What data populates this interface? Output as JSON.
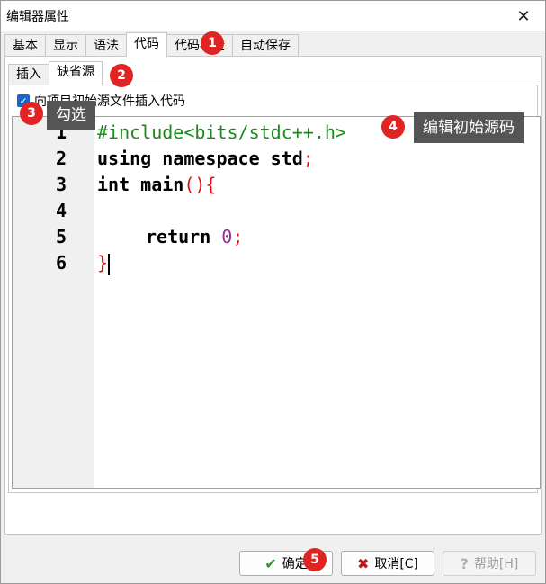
{
  "window": {
    "title": "编辑器属性"
  },
  "tabs": [
    "基本",
    "显示",
    "语法",
    "代码",
    "代码补全",
    "自动保存"
  ],
  "subtabs": [
    "插入",
    "缺省源"
  ],
  "checkbox": {
    "label": "向项目初始源文件插入代码",
    "checked": true
  },
  "editor": {
    "line_numbers": [
      "1",
      "2",
      "3",
      "4",
      "5",
      "6"
    ],
    "lines": {
      "l1": "#include<bits/stdc++.h>",
      "l2_kw": "using namespace std",
      "l2_p": ";",
      "l3_kw": "int main",
      "l3_p": "(){",
      "l5_kw": "return ",
      "l5_num": "0",
      "l5_p": ";",
      "l6_p": "}"
    }
  },
  "buttons": {
    "ok": {
      "label": "确定",
      "icon": "check-icon"
    },
    "cancel": {
      "label": "取消[C]",
      "icon": "x-icon"
    },
    "help": {
      "label": "帮助[H]",
      "icon": "help-icon"
    }
  },
  "annotations": {
    "badges": [
      "1",
      "2",
      "3",
      "4",
      "5"
    ],
    "callout3": "勾选",
    "callout4": "编辑初始源码"
  },
  "colors": {
    "badge": "#e02424",
    "callout": "#555555",
    "checkbox": "#1a66c7",
    "preprocessor": "#1a8a1a",
    "number": "#9a2a9a",
    "punctuation": "#e01010"
  }
}
